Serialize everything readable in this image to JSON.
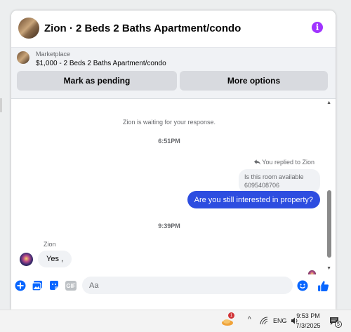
{
  "header": {
    "title": "Zion · 2 Beds 2 Baths Apartment/condo",
    "info_icon": "i"
  },
  "marketplace": {
    "label": "Marketplace",
    "listing": "$1,000 - 2 Beds 2 Baths Apartment/condo",
    "pending_button": "Mark as pending",
    "options_button": "More options"
  },
  "messages": {
    "waiting_notice": "Zion is waiting for your response.",
    "time_1": "6:51PM",
    "replied_label": "You replied to Zion",
    "quoted_text": "Is this room available 6095408706",
    "outgoing": "Are you still interested in property?",
    "time_2": "9:39PM",
    "sender_name": "Zion",
    "incoming": "Yes ,"
  },
  "composer": {
    "placeholder": "Aa",
    "gif_label": "GIF"
  },
  "taskbar": {
    "language": "ENG",
    "time": "9:53 PM",
    "date": "7/3/2025",
    "notification_count": "5",
    "weather_badge": "1"
  },
  "colors": {
    "accent": "#0866ff",
    "outgoing_bubble": "#2d4de0",
    "info": "#a033ff"
  }
}
